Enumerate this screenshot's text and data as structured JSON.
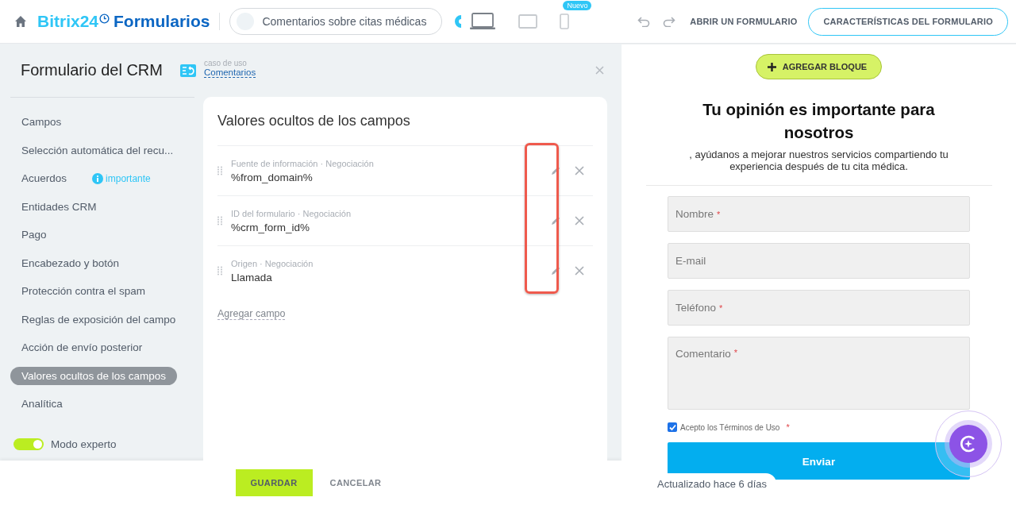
{
  "topbar": {
    "brand_a": "Bitrix24",
    "brand_b": "Formularios",
    "form_name": "Comentarios sobre citas médicas",
    "devices": [
      {
        "kind": "desktop",
        "selected": true
      },
      {
        "kind": "tablet",
        "selected": false
      },
      {
        "kind": "phone",
        "selected": false,
        "badge": "Nuevo"
      }
    ],
    "open_link": "ABRIR UN FORMULARIO",
    "features_button": "CARACTERÍSTICAS DEL FORMULARIO"
  },
  "header": {
    "title": "Formulario del CRM",
    "use_case_label": "caso de uso",
    "use_case_link": "Comentarios"
  },
  "sidebar": {
    "items": [
      {
        "label": "Campos",
        "selected": false
      },
      {
        "label": "Selección automática del recu...",
        "selected": false
      },
      {
        "label": "Acuerdos",
        "selected": false,
        "badge": "importante"
      },
      {
        "label": "Entidades CRM",
        "selected": false
      },
      {
        "label": "Pago",
        "selected": false
      },
      {
        "label": "Encabezado y botón",
        "selected": false
      },
      {
        "label": "Protección contra el spam",
        "selected": false
      },
      {
        "label": "Reglas de exposición del campo",
        "selected": false
      },
      {
        "label": "Acción de envío posterior",
        "selected": false
      },
      {
        "label": "Valores ocultos de los campos",
        "selected": true
      },
      {
        "label": "Analítica",
        "selected": false
      }
    ],
    "expert_mode": {
      "label": "Modo experto",
      "on": true
    }
  },
  "card": {
    "title": "Valores ocultos de los campos",
    "edit_highlighted": true,
    "rows": [
      {
        "label": "Fuente de información · Negociación",
        "value": "%from_domain%"
      },
      {
        "label": "ID del formulario · Negociación",
        "value": "%crm_form_id%"
      },
      {
        "label": "Origen · Negociación",
        "value": "Llamada"
      }
    ],
    "add_link": "Agregar campo"
  },
  "footer": {
    "save": "GUARDAR",
    "cancel": "CANCELAR"
  },
  "preview": {
    "add_block": "AGREGAR BLOQUE",
    "heading": "Tu opinión es importante para nosotros",
    "subheading": ", ayúdanos a mejorar nuestros servicios compartiendo tu experiencia después de tu cita médica.",
    "fields": [
      {
        "kind": "input",
        "placeholder": "Nombre",
        "required_mark": "*"
      },
      {
        "kind": "input",
        "placeholder": "E-mail"
      },
      {
        "kind": "input",
        "placeholder": "Teléfono",
        "required_mark": "*"
      },
      {
        "kind": "textarea",
        "placeholder": "Comentario",
        "required_mark": "*"
      }
    ],
    "consent": {
      "label": "Acepto los Términos de Uso",
      "checked": true,
      "required_mark": "*"
    },
    "submit": "Enviar",
    "updated": "Actualizado hace 6 días"
  }
}
